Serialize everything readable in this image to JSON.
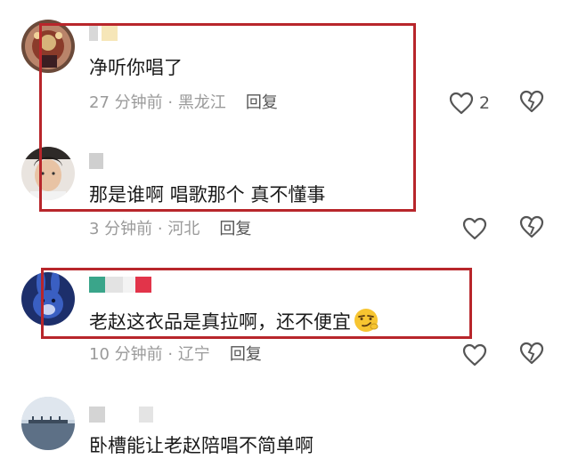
{
  "colors": {
    "highlight": "#b8262b",
    "meta_text": "#9a9a9a",
    "icon": "#555555"
  },
  "comments": [
    {
      "text": "净听你唱了",
      "time": "27 分钟前",
      "location": "黑龙江",
      "reply_label": "回复",
      "like_count": "2",
      "avatar": "crown-portrait"
    },
    {
      "text": "那是谁啊 唱歌那个 真不懂事",
      "time": "3 分钟前",
      "location": "河北",
      "reply_label": "回复",
      "like_count": "",
      "avatar": "young-man-portrait"
    },
    {
      "text": "老赵这衣品是真拉啊，还不便宜",
      "time": "10 分钟前",
      "location": "辽宁",
      "reply_label": "回复",
      "like_count": "",
      "avatar": "blue-rabbit-cartoon",
      "emoji": "smirk-emoji"
    },
    {
      "text": "卧槽能让老赵陪唱不简单啊",
      "avatar": "sea-landscape"
    }
  ],
  "separator": " · "
}
